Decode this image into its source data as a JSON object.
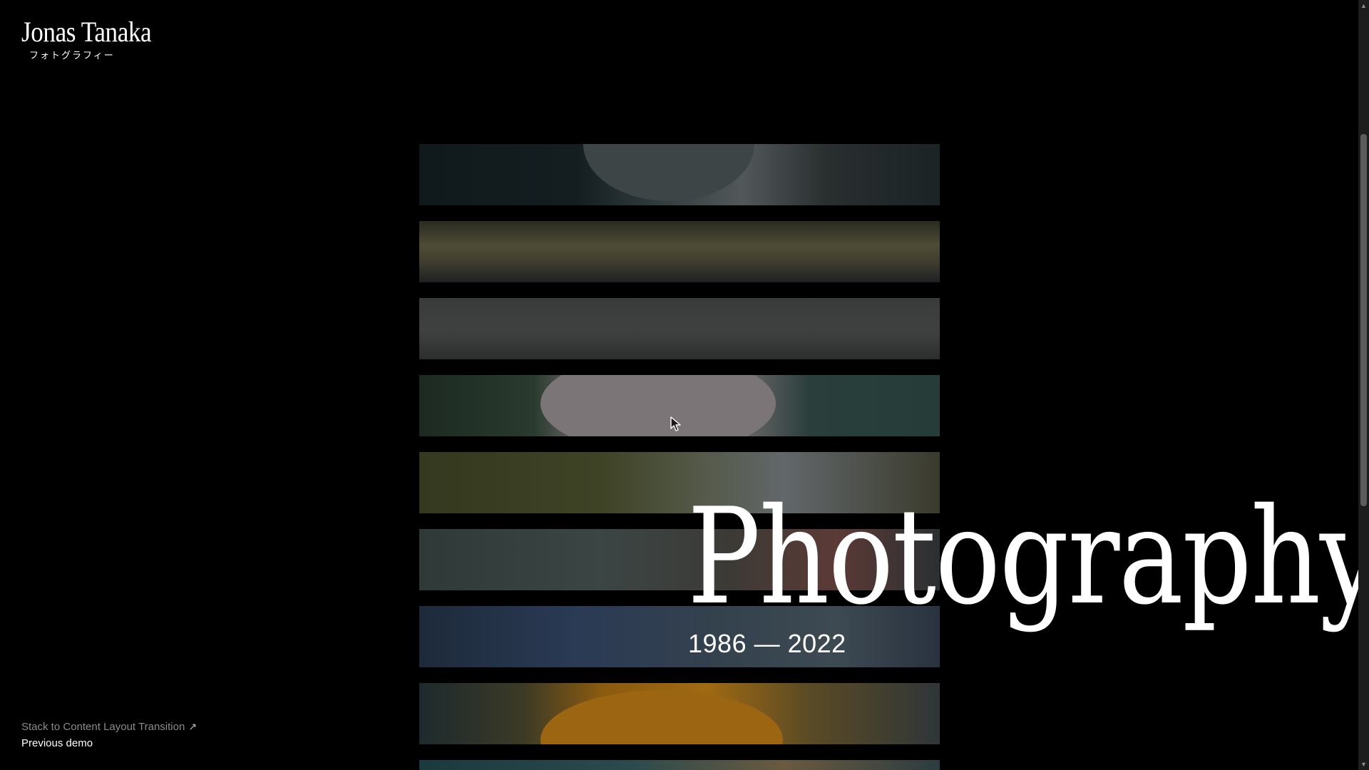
{
  "brand": {
    "name": "Jonas Tanaka",
    "subtitle": "フォトグラフィー"
  },
  "hero": {
    "title": "Photography",
    "years": "1986 — 2022"
  },
  "gallery": {
    "strips": [
      {
        "name": "portrait-face"
      },
      {
        "name": "house-balcony"
      },
      {
        "name": "car-interior"
      },
      {
        "name": "white-shirt"
      },
      {
        "name": "hand-on-grass"
      },
      {
        "name": "keyboard"
      },
      {
        "name": "blue-wall"
      },
      {
        "name": "orange-hoodie"
      },
      {
        "name": "teal-shirt"
      }
    ]
  },
  "footer": {
    "demo_title": "Stack to Content Layout Transition",
    "demo_arrow_icon": "arrow-up-right-icon",
    "previous_demo": "Previous demo"
  },
  "colors": {
    "background": "#000000",
    "text": "#ffffff",
    "muted_link": "#8a8a8a"
  }
}
